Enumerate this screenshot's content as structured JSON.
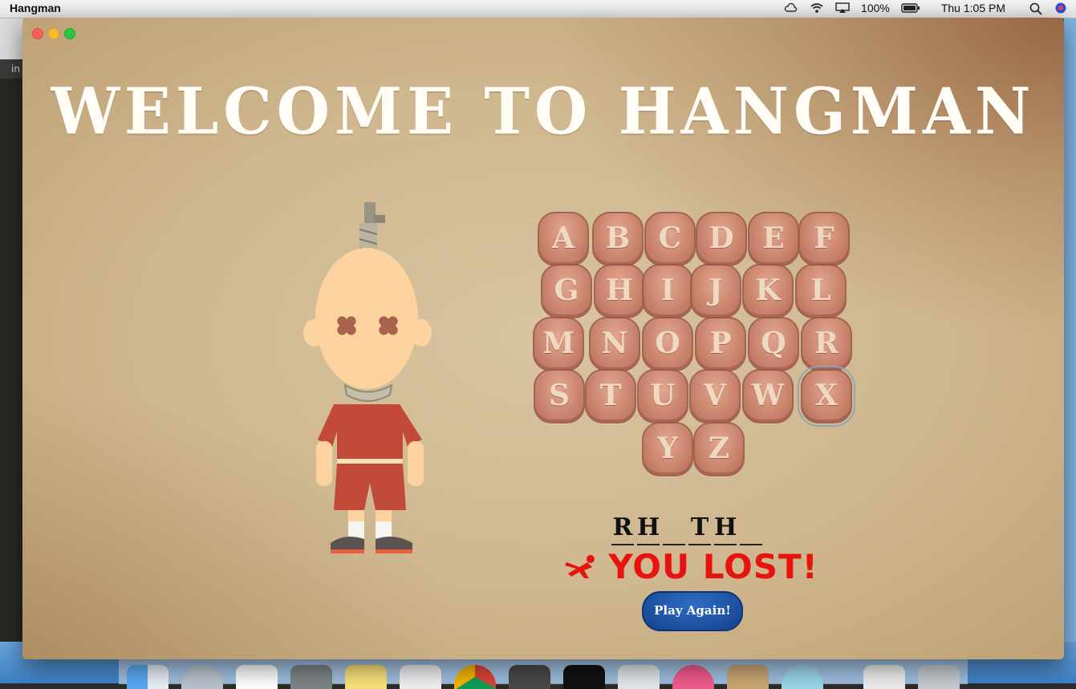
{
  "menubar": {
    "app_name": "Hangman",
    "battery": "100%",
    "clock": "Thu 1:05 PM"
  },
  "game": {
    "title": "WELCOME TO HANGMAN",
    "letters": [
      [
        "A",
        "B",
        "C",
        "D",
        "E",
        "F"
      ],
      [
        "G",
        "H",
        "I",
        "J",
        "K",
        "L"
      ],
      [
        "M",
        "N",
        "O",
        "P",
        "Q",
        "R"
      ],
      [
        "S",
        "T",
        "U",
        "V",
        "W",
        "X"
      ],
      [
        "Y",
        "Z"
      ]
    ],
    "word_slots": [
      "R",
      "H",
      "",
      "T",
      "H",
      ""
    ],
    "result_text": "YOU LOST!",
    "play_again_label": "Play Again!",
    "focused_letter": "X"
  },
  "colors": {
    "title": "#fffdf6",
    "letter_button": "#c97c68",
    "result": "#e8120f",
    "play_again": "#1b4f9e"
  },
  "editor_tab_label": "in"
}
